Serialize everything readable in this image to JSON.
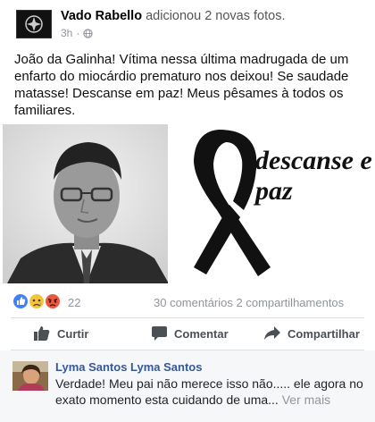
{
  "post": {
    "author": "Vado Rabello",
    "action": "adicionou 2 novas fotos.",
    "time": "3h",
    "separator": "·",
    "privacy_icon": "globe-icon",
    "text": "João da Galinha! Vítima nessa última madrugada de um enfarto do miocárdio prematuro nos deixou! Se saudade matasse! Descanse em paz! Meus pêsames à todos os familiares."
  },
  "photos": {
    "right_text_line1": "descanse e",
    "right_text_line2": "paz"
  },
  "reactions": {
    "icons": [
      "like-icon",
      "sad-icon",
      "angry-icon"
    ],
    "count": "22",
    "summary": "30 comentários 2 compartilhamentos"
  },
  "actions": {
    "like": "Curtir",
    "comment": "Comentar",
    "share": "Compartilhar"
  },
  "comment": {
    "author": "Lyma Santos Lyma Santos",
    "text": "Verdade!  Meu pai não merece isso não..... ele agora no exato momento esta cuidando de uma...",
    "see_more": "Ver mais"
  },
  "colors": {
    "link_blue": "#365899",
    "like_blue": "#4080ff",
    "reaction_yellow": "#f7c33d",
    "angry_red": "#e9573f",
    "meta_gray": "#90949c"
  }
}
